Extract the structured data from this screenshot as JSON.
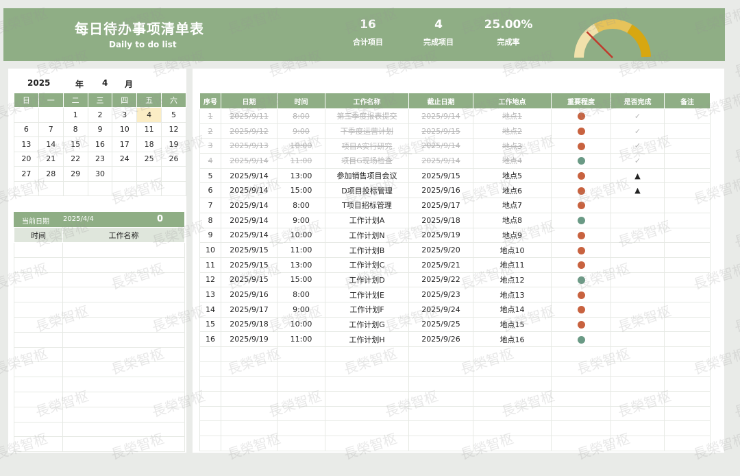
{
  "header": {
    "title_cn": "每日待办事项清单表",
    "title_en": "Daily to do list",
    "stats": [
      {
        "value": "16",
        "label": "合计项目"
      },
      {
        "value": "4",
        "label": "完成项目"
      },
      {
        "value": "25.00%",
        "label": "完成率"
      }
    ],
    "gauge_fraction": 0.25
  },
  "calendar": {
    "year": "2025",
    "year_label": "年",
    "month": "4",
    "month_label": "月",
    "weekdays": [
      "日",
      "一",
      "二",
      "三",
      "四",
      "五",
      "六"
    ],
    "weeks": [
      [
        "",
        "",
        "1",
        "2",
        "3",
        "4",
        "5"
      ],
      [
        "6",
        "7",
        "8",
        "9",
        "10",
        "11",
        "12"
      ],
      [
        "13",
        "14",
        "15",
        "16",
        "17",
        "18",
        "19"
      ],
      [
        "20",
        "21",
        "22",
        "23",
        "24",
        "25",
        "26"
      ],
      [
        "27",
        "28",
        "29",
        "30",
        "",
        "",
        ""
      ],
      [
        "",
        "",
        "",
        "",
        "",
        "",
        ""
      ]
    ],
    "today": "4"
  },
  "current": {
    "label": "当前日期",
    "date": "2025/4/4",
    "count": "0",
    "col_time": "时间",
    "col_name": "工作名称"
  },
  "tasks": {
    "headers": [
      "序号",
      "日期",
      "时间",
      "工作名称",
      "截止日期",
      "工作地点",
      "重要程度",
      "是否完成",
      "备注"
    ],
    "rows": [
      {
        "no": "1",
        "date": "2025/9/11",
        "time": "8:00",
        "name": "第三季度报表提交",
        "due": "2025/9/14",
        "place": "地点1",
        "level": "high",
        "done": "✓",
        "note": "",
        "finished": true
      },
      {
        "no": "2",
        "date": "2025/9/12",
        "time": "9:00",
        "name": "下季度运营计划",
        "due": "2025/9/15",
        "place": "地点2",
        "level": "high",
        "done": "✓",
        "note": "",
        "finished": true
      },
      {
        "no": "3",
        "date": "2025/9/13",
        "time": "10:00",
        "name": "项目A实行研究",
        "due": "2025/9/14",
        "place": "地点3",
        "level": "high",
        "done": "✓",
        "note": "",
        "finished": true
      },
      {
        "no": "4",
        "date": "2025/9/14",
        "time": "11:00",
        "name": "项目G现场检查",
        "due": "2025/9/14",
        "place": "地点4",
        "level": "low",
        "done": "✓",
        "note": "",
        "finished": true
      },
      {
        "no": "5",
        "date": "2025/9/14",
        "time": "13:00",
        "name": "参加销售项目会议",
        "due": "2025/9/15",
        "place": "地点5",
        "level": "high",
        "done": "▲",
        "note": "",
        "finished": false
      },
      {
        "no": "6",
        "date": "2025/9/14",
        "time": "15:00",
        "name": "D项目投标管理",
        "due": "2025/9/16",
        "place": "地点6",
        "level": "high",
        "done": "▲",
        "note": "",
        "finished": false
      },
      {
        "no": "7",
        "date": "2025/9/14",
        "time": "8:00",
        "name": "T项目招标管理",
        "due": "2025/9/17",
        "place": "地点7",
        "level": "high",
        "done": "",
        "note": "",
        "finished": false
      },
      {
        "no": "8",
        "date": "2025/9/14",
        "time": "9:00",
        "name": "工作计划A",
        "due": "2025/9/18",
        "place": "地点8",
        "level": "low",
        "done": "",
        "note": "",
        "finished": false
      },
      {
        "no": "9",
        "date": "2025/9/14",
        "time": "10:00",
        "name": "工作计划N",
        "due": "2025/9/19",
        "place": "地点9",
        "level": "high",
        "done": "",
        "note": "",
        "finished": false
      },
      {
        "no": "10",
        "date": "2025/9/15",
        "time": "11:00",
        "name": "工作计划B",
        "due": "2025/9/20",
        "place": "地点10",
        "level": "high",
        "done": "",
        "note": "",
        "finished": false
      },
      {
        "no": "11",
        "date": "2025/9/15",
        "time": "13:00",
        "name": "工作计划C",
        "due": "2025/9/21",
        "place": "地点11",
        "level": "high",
        "done": "",
        "note": "",
        "finished": false
      },
      {
        "no": "12",
        "date": "2025/9/15",
        "time": "15:00",
        "name": "工作计划D",
        "due": "2025/9/22",
        "place": "地点12",
        "level": "low",
        "done": "",
        "note": "",
        "finished": false
      },
      {
        "no": "13",
        "date": "2025/9/16",
        "time": "8:00",
        "name": "工作计划E",
        "due": "2025/9/23",
        "place": "地点13",
        "level": "high",
        "done": "",
        "note": "",
        "finished": false
      },
      {
        "no": "14",
        "date": "2025/9/17",
        "time": "9:00",
        "name": "工作计划F",
        "due": "2025/9/24",
        "place": "地点14",
        "level": "high",
        "done": "",
        "note": "",
        "finished": false
      },
      {
        "no": "15",
        "date": "2025/9/18",
        "time": "10:00",
        "name": "工作计划G",
        "due": "2025/9/25",
        "place": "地点15",
        "level": "high",
        "done": "",
        "note": "",
        "finished": false
      },
      {
        "no": "16",
        "date": "2025/9/19",
        "time": "11:00",
        "name": "工作计划H",
        "due": "2025/9/26",
        "place": "地点16",
        "level": "low",
        "done": "",
        "note": "",
        "finished": false
      }
    ]
  },
  "colors": {
    "header": "#8fae85",
    "dot_high": "#c8623f",
    "dot_low": "#6a9a85",
    "today_bg": "#fbedc5",
    "gauge_light": "#f1e1ab",
    "gauge_mid": "#e6c35a",
    "gauge_dark": "#d7a711",
    "gauge_needle": "#c0392b"
  },
  "icons": [
    "done-check-icon",
    "pending-triangle-icon",
    "importance-dot-icon",
    "gauge-needle-icon"
  ],
  "watermark": "長榮智枢"
}
